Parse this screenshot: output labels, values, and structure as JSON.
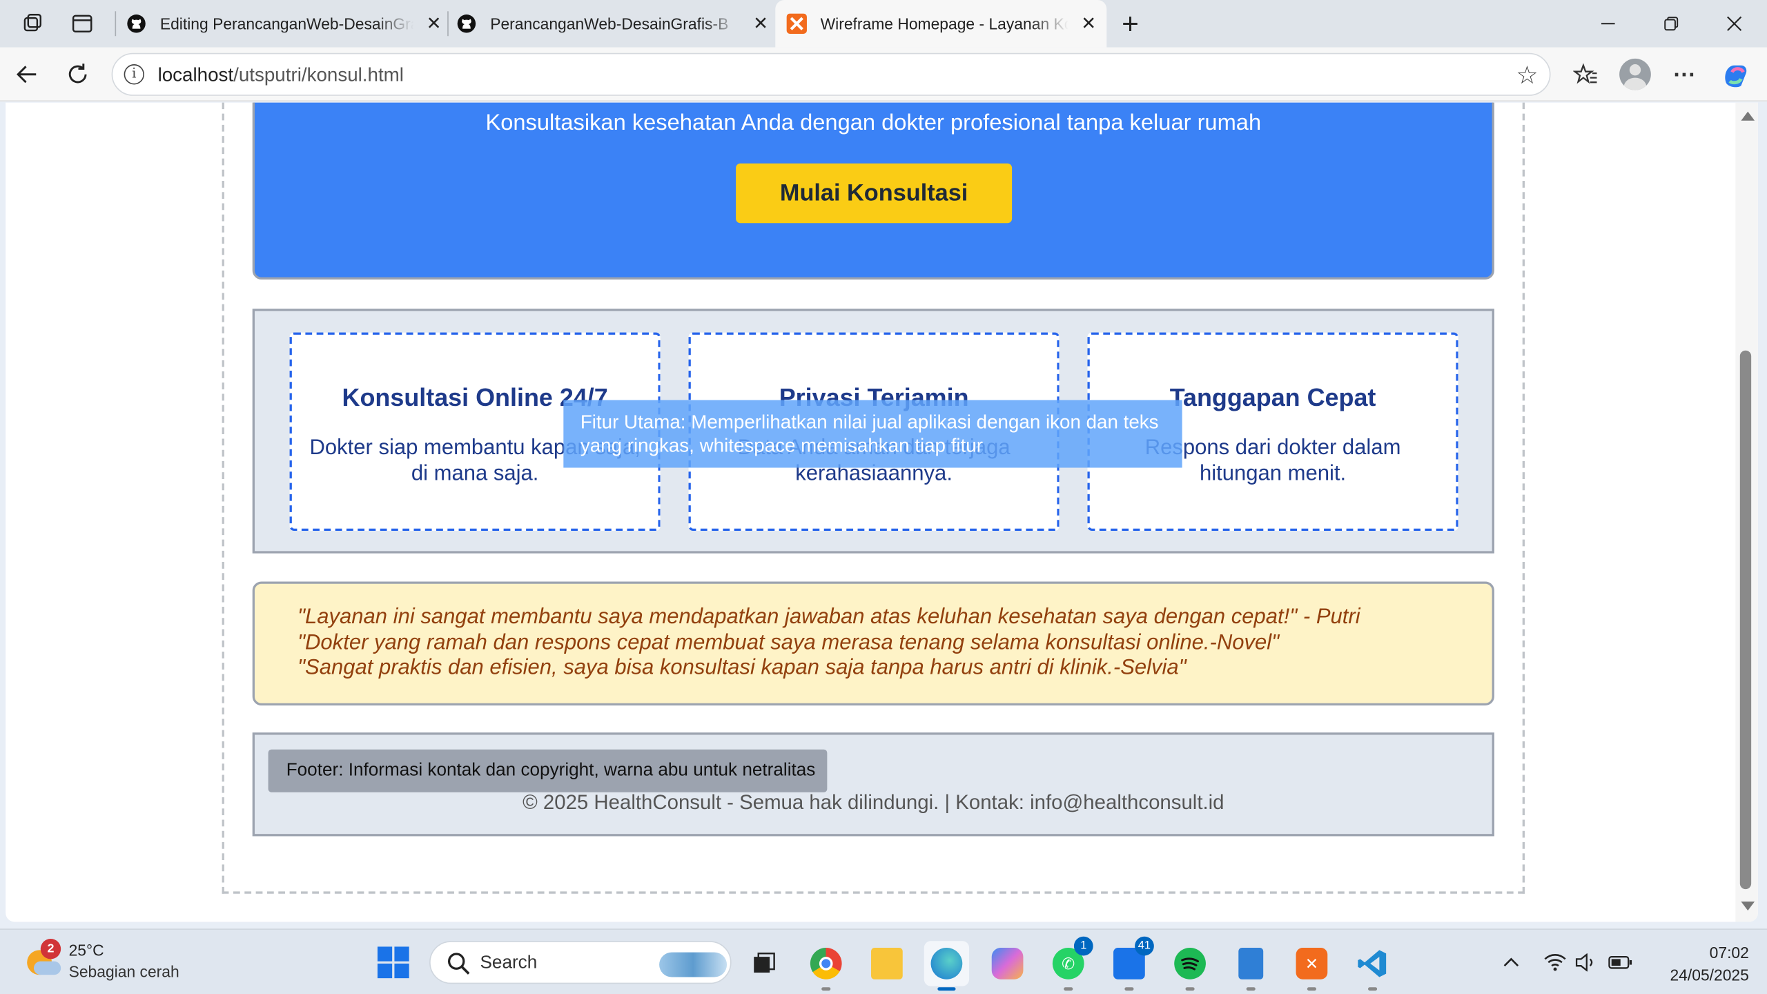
{
  "browser": {
    "tabs": [
      {
        "title": "Editing PerancanganWeb-DesainGrafis-B",
        "active": false
      },
      {
        "title": "PerancanganWeb-DesainGrafis-B",
        "active": false
      },
      {
        "title": "Wireframe Homepage - Layanan Konsultasi",
        "active": true
      }
    ],
    "new_tab_glyph": "+",
    "url_host": "localhost",
    "url_path": "/utsputri/konsul.html"
  },
  "hero": {
    "subtitle": "Konsultasikan kesehatan Anda dengan dokter profesional tanpa keluar rumah",
    "cta_label": "Mulai Konsultasi"
  },
  "features": {
    "cards": [
      {
        "title": "Konsultasi Online 24/7",
        "desc": "Dokter siap membantu kapan saja, di mana saja."
      },
      {
        "title": "Privasi Terjamin",
        "desc": "Data Anda aman dan terjaga kerahasiaannya."
      },
      {
        "title": "Tanggapan Cepat",
        "desc": "Respons dari dokter dalam hitungan menit."
      }
    ],
    "annotation": "Fitur Utama: Memperlihatkan nilai jual aplikasi dengan ikon dan teks yang ringkas, whitespace memisahkan tiap fitur"
  },
  "testimonials": [
    "\"Layanan ini sangat membantu saya mendapatkan jawaban atas keluhan kesehatan saya dengan cepat!\" - Putri",
    "\"Dokter yang ramah dan respons cepat membuat saya merasa tenang selama konsultasi online.-Novel\"",
    "\"Sangat praktis dan efisien, saya bisa konsultasi kapan saja tanpa harus antri di klinik.-Selvia\""
  ],
  "footer": {
    "annotation": "Footer: Informasi kontak dan copyright, warna abu untuk netralitas",
    "text": "© 2025 HealthConsult - Semua hak dilindungi. | Kontak: info@healthconsult.id"
  },
  "taskbar": {
    "weather_badge": "2",
    "temperature": "25°C",
    "condition": "Sebagian cerah",
    "search_label": "Search",
    "whatsapp_badge": "1",
    "store_badge": "41",
    "time": "07:02",
    "date": "24/05/2025"
  },
  "colors": {
    "hero_bg": "#3b82f6",
    "cta_bg": "#facc15",
    "feature_border": "#2563eb",
    "testimonial_bg": "#fef3c7",
    "testimonial_text": "#92400e",
    "footer_bg": "#e2e8f0"
  },
  "icons": [
    "workspaces-icon",
    "tab-actions-icon",
    "github-icon",
    "xampp-icon",
    "close-icon",
    "back-icon",
    "refresh-icon",
    "info-icon",
    "star-icon",
    "favorites-icon",
    "profile-icon",
    "more-icon",
    "copilot-icon"
  ]
}
